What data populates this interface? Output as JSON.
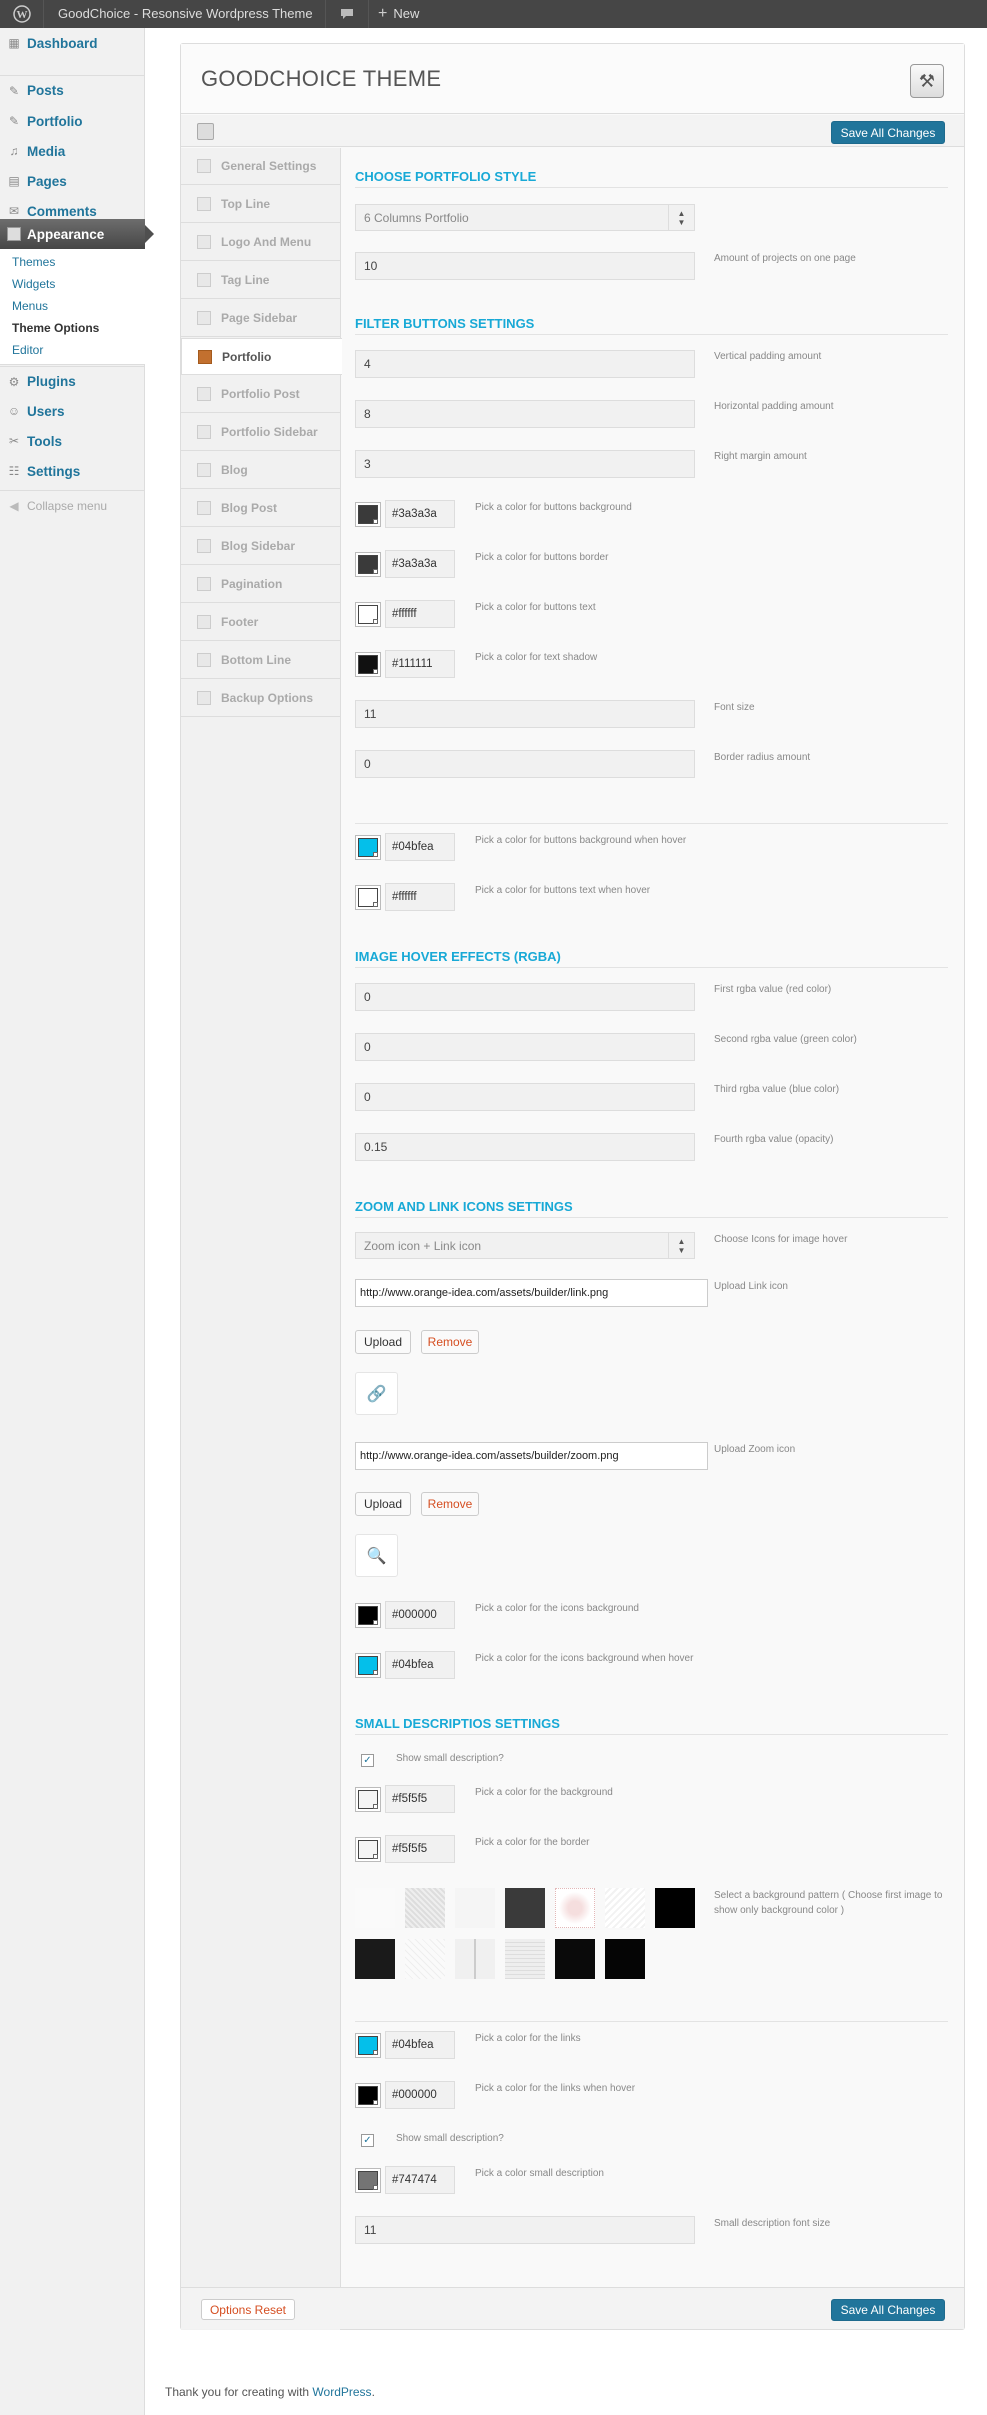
{
  "admin_bar": {
    "site_name": "GoodChoice - Resonsive Wordpress Theme",
    "new_label": "New"
  },
  "sidebar": {
    "items": [
      {
        "label": "Dashboard",
        "icon": "dashboard-icon"
      },
      {
        "label": "Posts",
        "icon": "pin-icon"
      },
      {
        "label": "Portfolio",
        "icon": "pin-icon"
      },
      {
        "label": "Media",
        "icon": "media-icon"
      },
      {
        "label": "Pages",
        "icon": "pages-icon"
      },
      {
        "label": "Comments",
        "icon": "comments-icon"
      },
      {
        "label": "Appearance",
        "icon": "appearance-icon"
      },
      {
        "label": "Plugins",
        "icon": "plugin-icon"
      },
      {
        "label": "Users",
        "icon": "users-icon"
      },
      {
        "label": "Tools",
        "icon": "tools-icon"
      },
      {
        "label": "Settings",
        "icon": "settings-icon"
      }
    ],
    "appearance_sub": [
      "Themes",
      "Widgets",
      "Menus",
      "Theme Options",
      "Editor"
    ],
    "collapse": "Collapse menu"
  },
  "panel": {
    "title": "GOODCHOICE THEME",
    "save_label": "Save All Changes",
    "reset_label": "Options Reset"
  },
  "tabs": [
    "General Settings",
    "Top Line",
    "Logo And Menu",
    "Tag Line",
    "Page Sidebar",
    "Portfolio",
    "Portfolio Post",
    "Portfolio Sidebar",
    "Blog",
    "Blog Post",
    "Blog Sidebar",
    "Pagination",
    "Footer",
    "Bottom Line",
    "Backup Options"
  ],
  "content": {
    "sec_portfolio": "CHOOSE PORTFOLIO STYLE",
    "portfolio_style": "6 Columns Portfolio",
    "projects_value": "10",
    "projects_desc": "Amount of projects on one page",
    "sec_filter": "FILTER BUTTONS SETTINGS",
    "vpad": "4",
    "vpad_desc": "Vertical padding amount",
    "hpad": "8",
    "hpad_desc": "Horizontal padding amount",
    "rmargin": "3",
    "rmargin_desc": "Right margin amount",
    "c_bg": "#3a3a3a",
    "c_bg_desc": "Pick a color for buttons background",
    "c_border": "#3a3a3a",
    "c_border_desc": "Pick a color for buttons border",
    "c_text": "#ffffff",
    "c_text_desc": "Pick a color for buttons text",
    "c_shadow": "#111111",
    "c_shadow_desc": "Pick a color for text shadow",
    "fsize": "11",
    "fsize_desc": "Font size",
    "radius": "0",
    "radius_desc": "Border radius amount",
    "c_bghover": "#04bfea",
    "c_bghover_desc": "Pick a color for buttons background when hover",
    "c_texthover": "#ffffff",
    "c_texthover_desc": "Pick a color for buttons text when hover",
    "sec_rgba": "IMAGE HOVER EFFECTS (RGBA)",
    "r": "0",
    "r_desc": "First rgba value (red color)",
    "g": "0",
    "g_desc": "Second rgba value (green color)",
    "b": "0",
    "b_desc": "Third rgba value (blue color)",
    "a": "0.15",
    "a_desc": "Fourth rgba value (opacity)",
    "sec_icons": "ZOOM AND LINK ICONS SETTINGS",
    "icons_select": "Zoom icon + Link icon",
    "icons_desc": "Choose Icons for image hover",
    "link_url": "http://www.orange-idea.com/assets/builder/link.png",
    "link_desc": "Upload Link icon",
    "upload": "Upload",
    "remove": "Remove",
    "zoom_url": "http://www.orange-idea.com/assets/builder/zoom.png",
    "zoom_desc": "Upload Zoom icon",
    "c_iconbg": "#000000",
    "c_iconbg_desc": "Pick a color for the icons background",
    "c_iconhover": "#04bfea",
    "c_iconhover_desc": "Pick a color for the icons background when hover",
    "sec_small": "SMALL DESCRIPTIOS SETTINGS",
    "show_desc": "Show small description?",
    "c_sbg": "#f5f5f5",
    "c_sbg_desc": "Pick a color for the background",
    "c_sborder": "#f5f5f5",
    "c_sborder_desc": "Pick a color for the border",
    "pattern_desc": "Select a background pattern ( Choose first image to show only background color )",
    "c_links": "#04bfea",
    "c_links_desc": "Pick a color for the links",
    "c_linkshover": "#000000",
    "c_linkshover_desc": "Pick a color for the links when hover",
    "show_desc2": "Show small description?",
    "c_sdesc": "#747474",
    "c_sdesc_desc": "Pick a color small description",
    "sfont": "11",
    "sfont_desc": "Small description font size"
  },
  "colors": {
    "accent": "#18a9d6",
    "wp_blue": "#21759b"
  },
  "footer": {
    "text": "Thank you for creating with",
    "link": "WordPress",
    "end": "."
  }
}
